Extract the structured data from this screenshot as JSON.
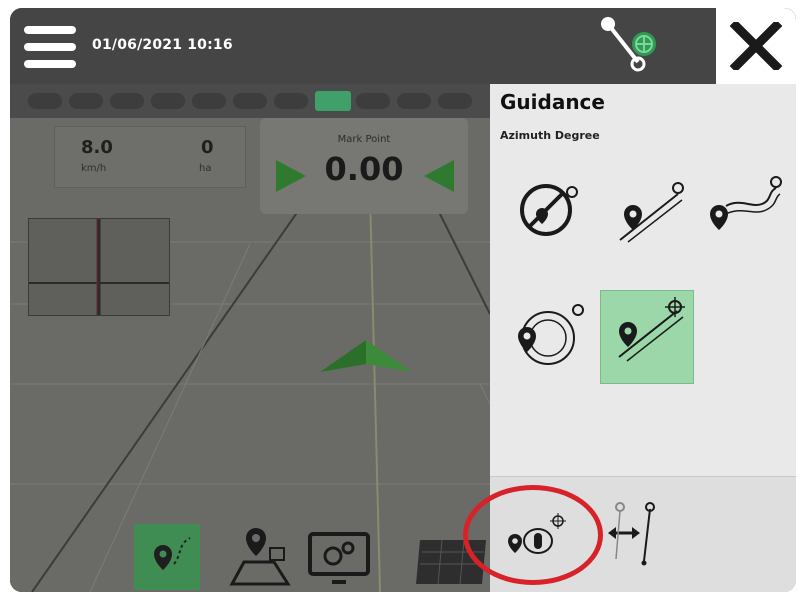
{
  "topbar": {
    "datetime": "01/06/2021 10:16",
    "menu_icon": "hamburger-menu-icon",
    "gps_icon": "gps-status-icon",
    "close_icon": "close-icon"
  },
  "map": {
    "speed_value": "8.0",
    "speed_unit": "km/h",
    "area_value": "0",
    "area_unit": "ha",
    "cross_track_label": "Mark Point",
    "cross_track_value": "0.00",
    "boom_sections_total": 11,
    "boom_active_index": 7
  },
  "bottom_tray": [
    {
      "icon": "guidance-mode-icon",
      "selected": true
    },
    {
      "icon": "field-boundary-icon",
      "selected": false
    },
    {
      "icon": "console-settings-icon",
      "selected": false
    },
    {
      "icon": "coverage-map-icon",
      "selected": false
    }
  ],
  "panel": {
    "title": "Guidance",
    "subtitle": "Azimuth Degree",
    "options": [
      {
        "icon": "no-guidance-icon",
        "selected": false
      },
      {
        "icon": "straight-ab-guidance-icon",
        "selected": false
      },
      {
        "icon": "curved-ab-guidance-icon",
        "selected": false
      },
      {
        "icon": "circle-pivot-guidance-icon",
        "selected": false
      },
      {
        "icon": "azimuth-degree-guidance-icon",
        "selected": true
      }
    ],
    "bottom_tools": [
      {
        "icon": "mark-point-tool-icon",
        "highlighted": true
      },
      {
        "icon": "guideline-shift-icon",
        "highlighted": false
      }
    ]
  },
  "colors": {
    "topbar": "#454545",
    "panel": "#e9e9e9",
    "selected": "#9bd7a9",
    "highlight_circle": "#d8222a",
    "guidance_green": "#2f7a2f"
  }
}
